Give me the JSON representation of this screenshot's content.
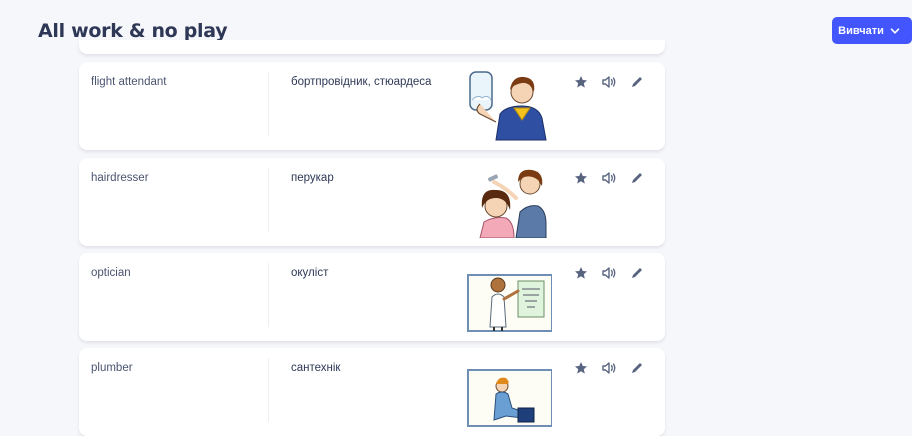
{
  "header": {
    "title": "All work & no play",
    "study_button": {
      "label": "Вивчати",
      "icon": "chevron-down-icon"
    }
  },
  "cards": [
    {
      "term": "flight attendant",
      "definition": "бортпровідник, стюардеса",
      "image": "flight-attendant-illustration"
    },
    {
      "term": "hairdresser",
      "definition": "перукар",
      "image": "hairdresser-illustration"
    },
    {
      "term": "optician",
      "definition": "окуліст",
      "image": "optician-illustration"
    },
    {
      "term": "plumber",
      "definition": "сантехнік",
      "image": "plumber-illustration"
    }
  ],
  "card_actions": [
    "star-icon",
    "audio-icon",
    "edit-icon"
  ],
  "colors": {
    "accent": "#4255ff",
    "text": "#2e3856",
    "icon": "#586380",
    "background": "#f6f7fb"
  }
}
